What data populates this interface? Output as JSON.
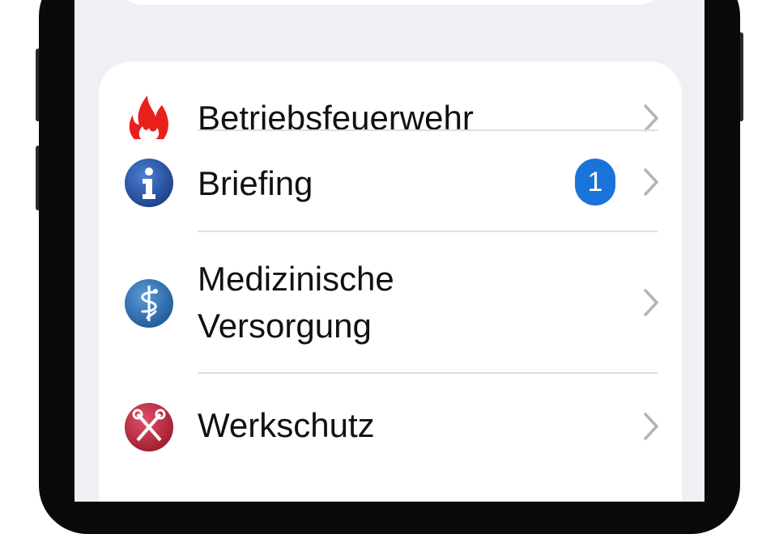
{
  "menu": {
    "items": [
      {
        "label": "Betriebsfeuerwehr",
        "icon": "fire-icon"
      },
      {
        "label": "Briefing",
        "icon": "info-icon",
        "badge": "1"
      },
      {
        "label_line1": "Medizinische",
        "label_line2": "Versorgung",
        "icon": "medical-caduceus-icon"
      },
      {
        "label": "Werkschutz",
        "icon": "crossed-keys-icon"
      }
    ]
  },
  "colors": {
    "background": "#efeff4",
    "card": "#ffffff",
    "badge": "#1a73d9",
    "chevron": "#b3b3b8",
    "fire": "#e8201c",
    "info_blue": "#2456a8",
    "medical_blue": "#2c6fb3",
    "security_red": "#c8283a"
  }
}
